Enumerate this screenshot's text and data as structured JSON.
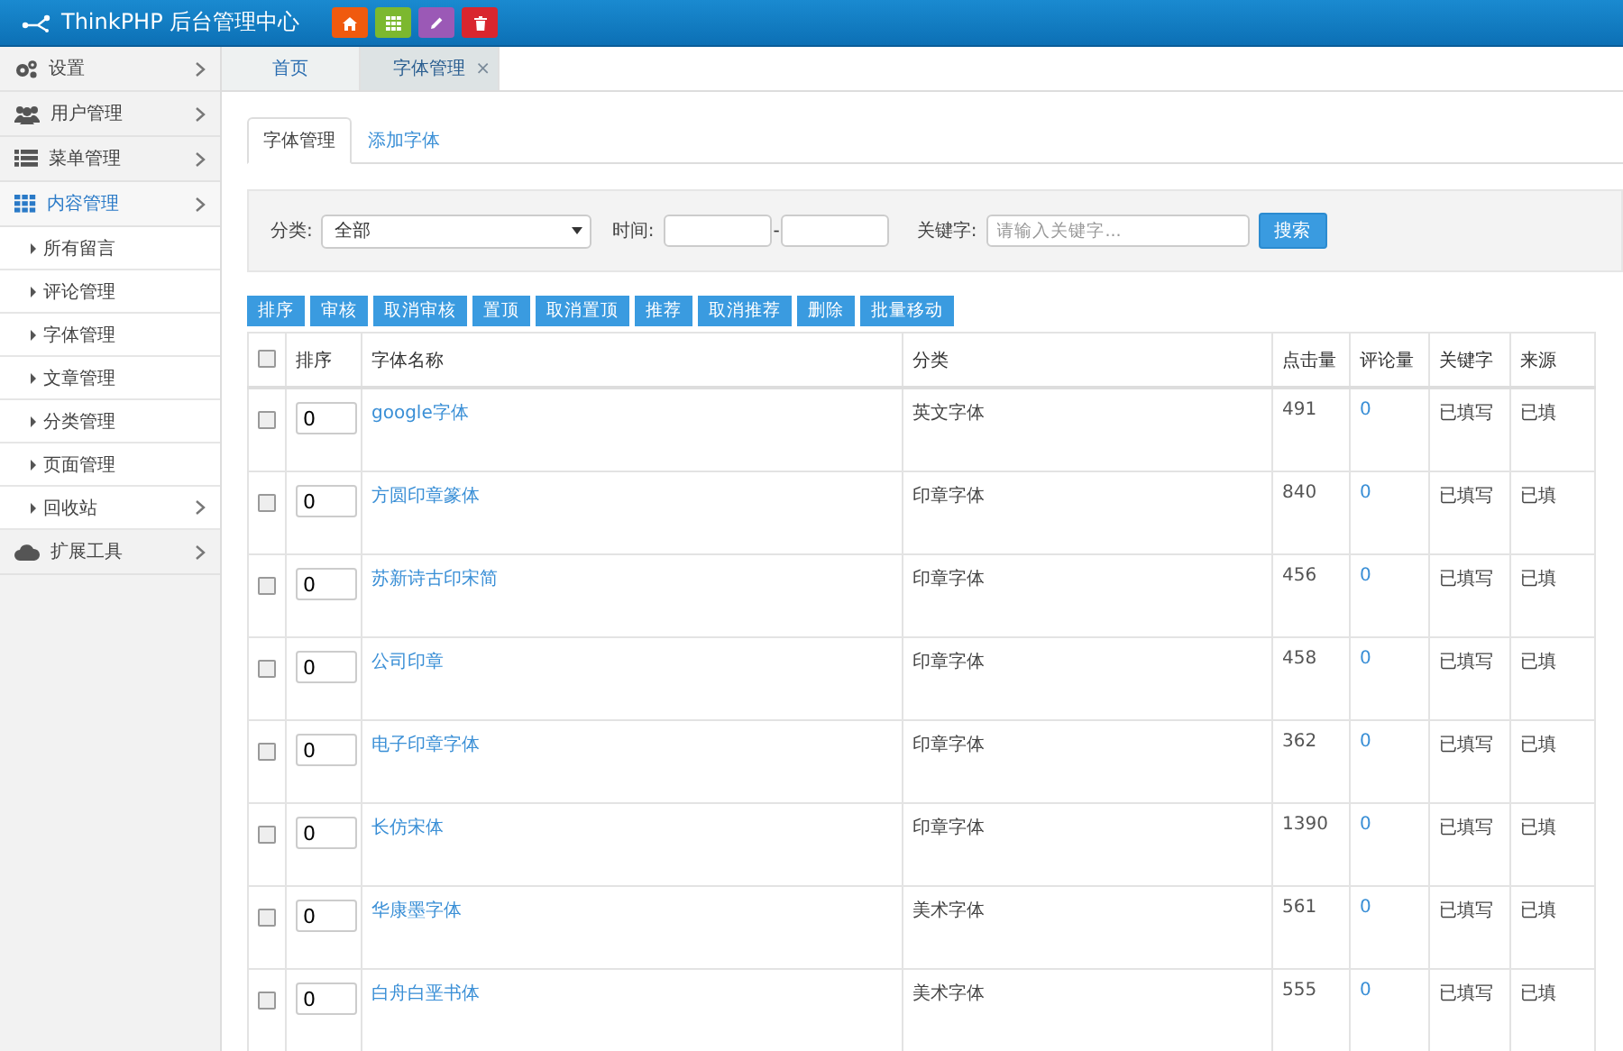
{
  "header": {
    "title": "ThinkPHP 后台管理中心",
    "buttons": [
      {
        "kind": "home",
        "color": "#f05a0e"
      },
      {
        "kind": "grid",
        "color": "#7cb82f"
      },
      {
        "kind": "edit",
        "color": "#9b59b6"
      },
      {
        "kind": "trash",
        "color": "#d9262e"
      }
    ]
  },
  "sidebar": {
    "items": [
      {
        "kind": "gear",
        "label": "设置",
        "expanded": false
      },
      {
        "kind": "users",
        "label": "用户管理",
        "expanded": false
      },
      {
        "kind": "list",
        "label": "菜单管理",
        "expanded": false
      },
      {
        "kind": "grid",
        "label": "内容管理",
        "expanded": true,
        "children": [
          {
            "label": "所有留言",
            "has_arrow": false
          },
          {
            "label": "评论管理",
            "has_arrow": false
          },
          {
            "label": "字体管理",
            "has_arrow": false
          },
          {
            "label": "文章管理",
            "has_arrow": false
          },
          {
            "label": "分类管理",
            "has_arrow": false
          },
          {
            "label": "页面管理",
            "has_arrow": false
          },
          {
            "label": "回收站",
            "has_arrow": true
          }
        ]
      },
      {
        "kind": "cloud",
        "label": "扩展工具",
        "expanded": false
      }
    ]
  },
  "tabs": [
    {
      "label": "首页",
      "selected": false,
      "closable": false
    },
    {
      "label": "字体管理",
      "selected": true,
      "closable": true
    }
  ],
  "close_glyph": "×",
  "subtabs": [
    {
      "label": "字体管理",
      "selected": true
    },
    {
      "label": "添加字体",
      "selected": false
    }
  ],
  "filter": {
    "category_label": "分类:",
    "category_value": "全部",
    "time_label": "时间:",
    "time_separator": "-",
    "keyword_label": "关键字:",
    "keyword_placeholder": "请输入关键字...",
    "search_button": "搜索"
  },
  "actions": [
    "排序",
    "审核",
    "取消审核",
    "置顶",
    "取消置顶",
    "推荐",
    "取消推荐",
    "删除",
    "批量移动"
  ],
  "table": {
    "select_all_checked": false,
    "columns": [
      "排序",
      "字体名称",
      "分类",
      "点击量",
      "评论量",
      "关键字",
      "来源"
    ],
    "rows": [
      {
        "checked": false,
        "sort": "0",
        "name": "google字体",
        "category": "英文字体",
        "clicks": "491",
        "comments": "0",
        "keyword": "已填写",
        "source": "已填"
      },
      {
        "checked": false,
        "sort": "0",
        "name": "方圆印章篆体",
        "category": "印章字体",
        "clicks": "840",
        "comments": "0",
        "keyword": "已填写",
        "source": "已填"
      },
      {
        "checked": false,
        "sort": "0",
        "name": "苏新诗古印宋简",
        "category": "印章字体",
        "clicks": "456",
        "comments": "0",
        "keyword": "已填写",
        "source": "已填"
      },
      {
        "checked": false,
        "sort": "0",
        "name": "公司印章",
        "category": "印章字体",
        "clicks": "458",
        "comments": "0",
        "keyword": "已填写",
        "source": "已填"
      },
      {
        "checked": false,
        "sort": "0",
        "name": "电子印章字体",
        "category": "印章字体",
        "clicks": "362",
        "comments": "0",
        "keyword": "已填写",
        "source": "已填"
      },
      {
        "checked": false,
        "sort": "0",
        "name": "长仿宋体",
        "category": "印章字体",
        "clicks": "1390",
        "comments": "0",
        "keyword": "已填写",
        "source": "已填"
      },
      {
        "checked": false,
        "sort": "0",
        "name": "华康墨字体",
        "category": "美术字体",
        "clicks": "561",
        "comments": "0",
        "keyword": "已填写",
        "source": "已填"
      },
      {
        "checked": false,
        "sort": "0",
        "name": "白舟白垩书体",
        "category": "美术字体",
        "clicks": "555",
        "comments": "0",
        "keyword": "已填写",
        "source": "已填"
      }
    ]
  }
}
